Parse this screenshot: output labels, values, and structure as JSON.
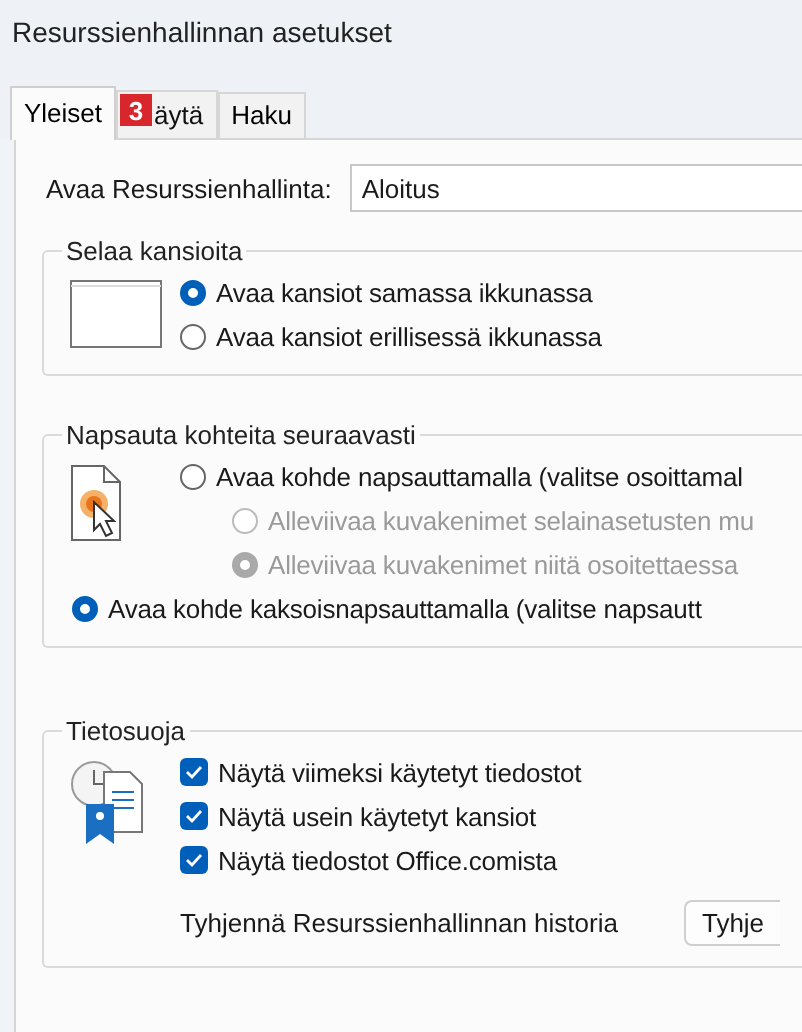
{
  "window": {
    "title": "Resurssienhallinnan asetukset"
  },
  "badge": {
    "text": "3"
  },
  "tabs": [
    {
      "label": "Yleiset",
      "selected": true
    },
    {
      "label": "äytä",
      "selected": false
    },
    {
      "label": "Haku",
      "selected": false
    }
  ],
  "open_explorer": {
    "label": "Avaa Resurssienhallinta:",
    "value": "Aloitus"
  },
  "groups": [
    {
      "title": "Selaa kansioita",
      "options": [
        {
          "kind": "radio",
          "label": "Avaa kansiot samassa ikkunassa",
          "checked": true,
          "disabled": false
        },
        {
          "kind": "radio",
          "label": "Avaa kansiot erillisessä ikkunassa",
          "checked": false,
          "disabled": false
        }
      ]
    },
    {
      "title": "Napsauta kohteita seuraavasti",
      "options": [
        {
          "kind": "radio",
          "label": "Avaa kohde napsauttamalla (valitse osoittamal",
          "checked": false,
          "disabled": false,
          "children": [
            {
              "kind": "radio",
              "label": "Alleviivaa kuvakenimet selainasetusten mu",
              "checked": false,
              "disabled": true
            },
            {
              "kind": "radio",
              "label": "Alleviivaa kuvakenimet niitä osoitettaessa",
              "checked": true,
              "disabled": true
            }
          ]
        },
        {
          "kind": "radio-wide",
          "label": "Avaa kohde kaksoisnapsauttamalla (valitse napsautt",
          "checked": true,
          "disabled": false
        }
      ]
    },
    {
      "title": "Tietosuoja",
      "options": [
        {
          "kind": "checkbox",
          "label": "Näytä viimeksi käytetyt tiedostot",
          "checked": true,
          "disabled": false
        },
        {
          "kind": "checkbox",
          "label": "Näytä usein käytetyt kansiot",
          "checked": true,
          "disabled": false
        },
        {
          "kind": "checkbox",
          "label": "Näytä tiedostot Office.comista",
          "checked": true,
          "disabled": false
        },
        {
          "kind": "button-row",
          "label": "Tyhjennä Resurssienhallinnan historia",
          "button": "Tyhje"
        }
      ]
    }
  ]
}
